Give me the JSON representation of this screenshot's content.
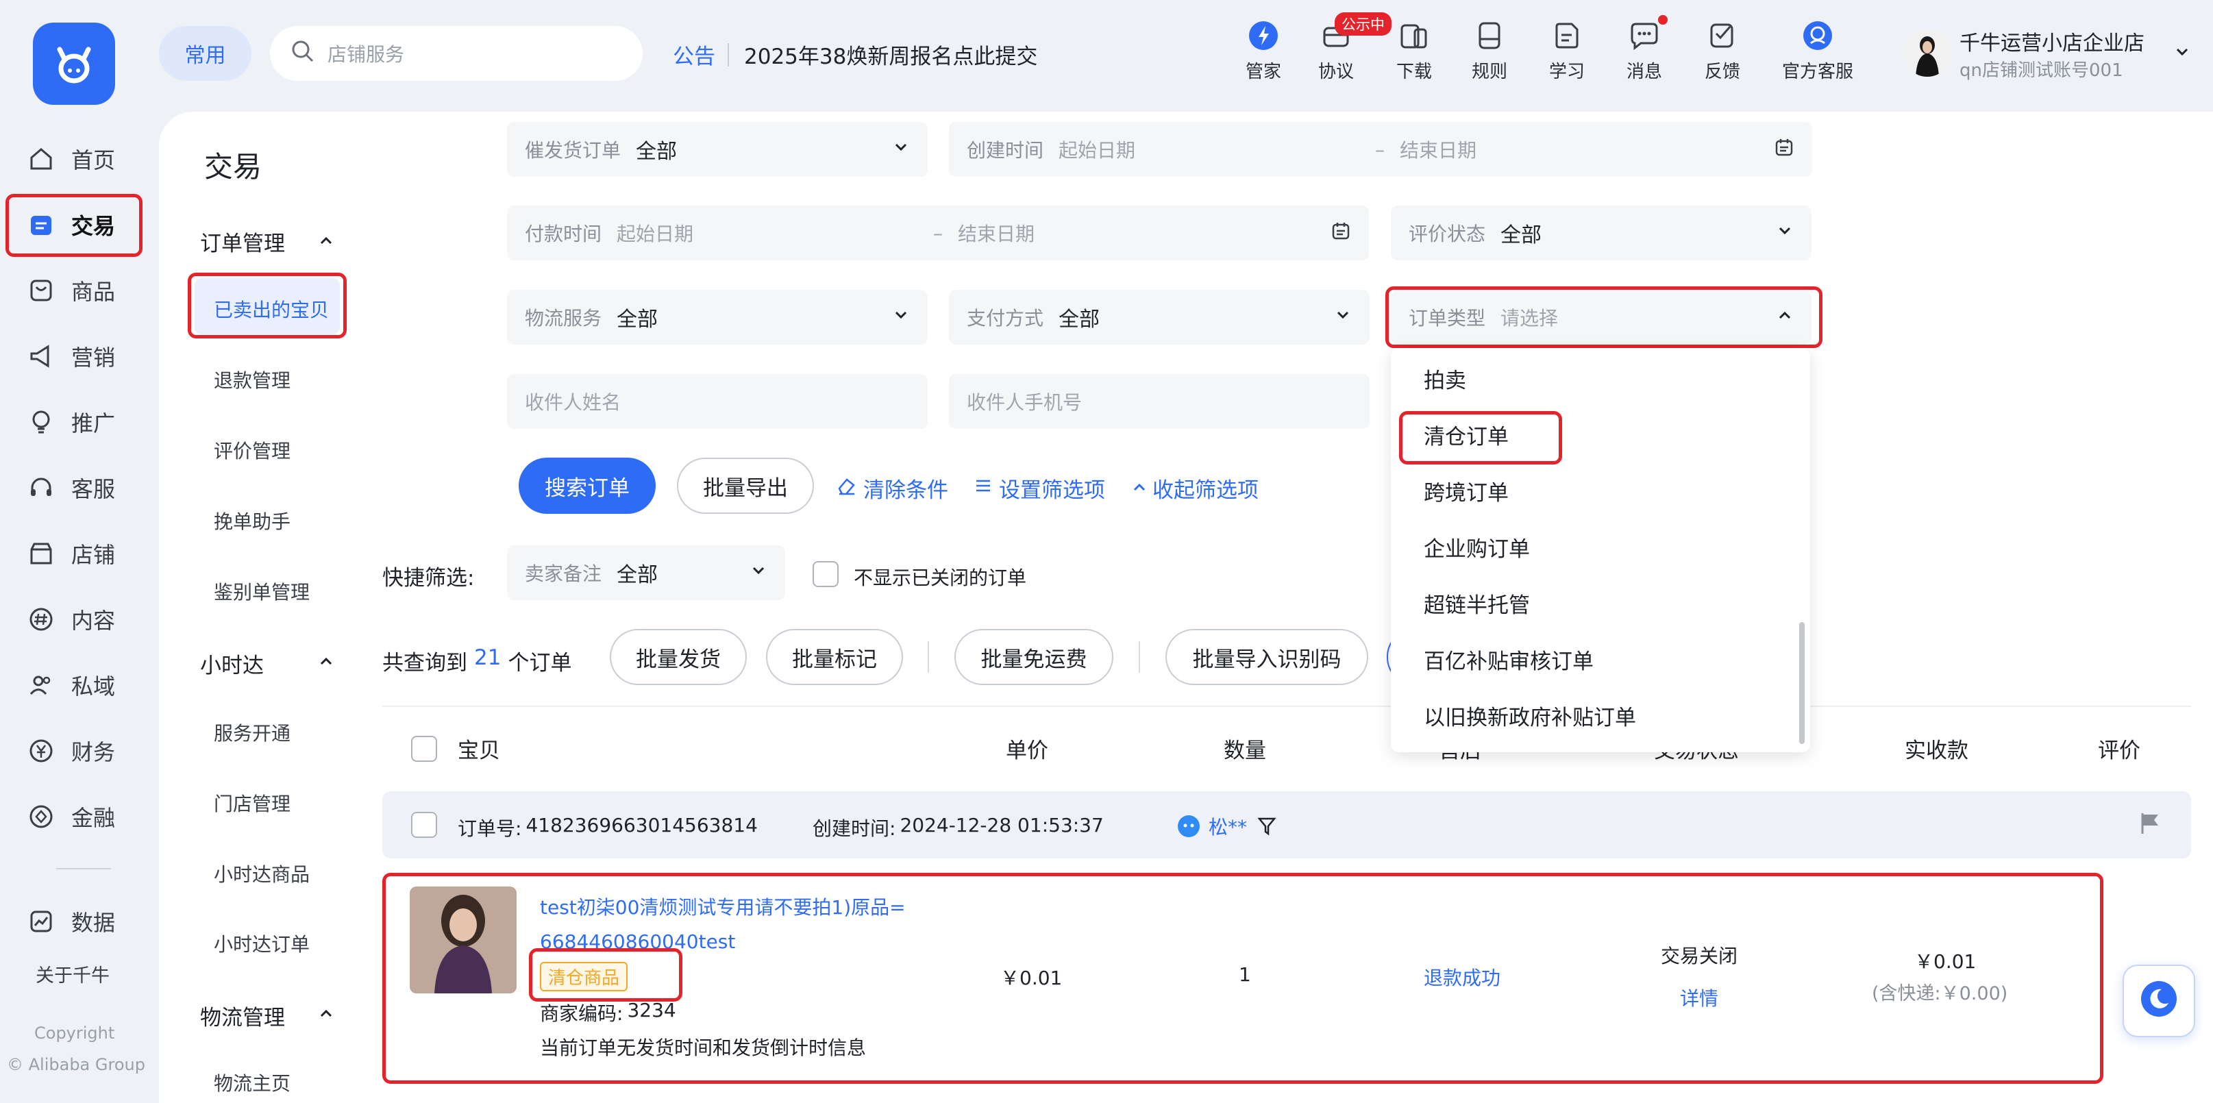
{
  "nav": {
    "items": [
      {
        "label": "首页",
        "icon": "home-icon"
      },
      {
        "label": "交易",
        "icon": "trade-icon"
      },
      {
        "label": "商品",
        "icon": "goods-icon"
      },
      {
        "label": "营销",
        "icon": "megaphone-icon"
      },
      {
        "label": "推广",
        "icon": "bulb-icon"
      },
      {
        "label": "客服",
        "icon": "headset-icon"
      },
      {
        "label": "店铺",
        "icon": "store-icon"
      },
      {
        "label": "内容",
        "icon": "hash-icon"
      },
      {
        "label": "私域",
        "icon": "users-icon"
      },
      {
        "label": "财务",
        "icon": "yen-icon"
      },
      {
        "label": "金融",
        "icon": "finance-icon"
      }
    ],
    "data_label": "数据",
    "about": "关于千牛",
    "copyright": "Copyright",
    "company": "© Alibaba Group"
  },
  "header": {
    "common": "常用",
    "search_placeholder": "店铺服务",
    "notice_label": "公告",
    "notice_text": "2025年38焕新周报名点此提交",
    "tools": [
      {
        "label": "管家",
        "icon": "butler-icon"
      },
      {
        "label": "协议",
        "icon": "agreement-icon",
        "badge": "公示中"
      },
      {
        "label": "下载",
        "icon": "download-icon"
      },
      {
        "label": "规则",
        "icon": "rules-icon"
      },
      {
        "label": "学习",
        "icon": "learn-icon"
      },
      {
        "label": "消息",
        "icon": "message-icon"
      },
      {
        "label": "反馈",
        "icon": "feedback-icon"
      },
      {
        "label": "官方客服",
        "icon": "official-service-icon"
      }
    ],
    "user": {
      "shop": "千牛运营小店企业店",
      "account": "qn店铺测试账号001"
    }
  },
  "sidebar": {
    "title": "交易",
    "groups": [
      {
        "label": "订单管理",
        "items": [
          "已卖出的宝贝",
          "退款管理",
          "评价管理",
          "挽单助手",
          "鉴别单管理"
        ]
      },
      {
        "label": "小时达",
        "items": [
          "服务开通",
          "门店管理",
          "小时达商品",
          "小时达订单"
        ]
      },
      {
        "label": "物流管理",
        "items": [
          "物流主页"
        ]
      }
    ]
  },
  "filters": {
    "remind": {
      "label": "催发货订单",
      "value": "全部"
    },
    "created": {
      "label": "创建时间",
      "start": "起始日期",
      "end": "结束日期"
    },
    "paid": {
      "label": "付款时间",
      "start": "起始日期",
      "end": "结束日期"
    },
    "review": {
      "label": "评价状态",
      "value": "全部"
    },
    "logistics": {
      "label": "物流服务",
      "value": "全部"
    },
    "payment": {
      "label": "支付方式",
      "value": "全部"
    },
    "order_type": {
      "label": "订单类型",
      "placeholder": "请选择"
    },
    "receiver_name": "收件人姓名",
    "receiver_phone": "收件人手机号",
    "search_btn": "搜索订单",
    "export_btn": "批量导出",
    "clear": "清除条件",
    "set_filters": "设置筛选项",
    "collapse": "收起筛选项",
    "dash": "–"
  },
  "quick": {
    "label": "快捷筛选:",
    "remark_label": "卖家备注",
    "remark_value": "全部",
    "hide_closed": "不显示已关闭的订单"
  },
  "summary": {
    "prefix": "共查询到",
    "count": "21",
    "suffix": "个订单",
    "actions": [
      "批量发货",
      "批量标记",
      "批量免运费",
      "批量导入识别码"
    ]
  },
  "dropdown": {
    "options": [
      "拍卖",
      "清仓订单",
      "跨境订单",
      "企业购订单",
      "超链半托管",
      "百亿补贴审核订单",
      "以旧换新政府补贴订单"
    ]
  },
  "table": {
    "headers": {
      "item": "宝贝",
      "price": "单价",
      "qty": "数量",
      "aftersale": "售后",
      "status": "交易状态",
      "received": "实收款",
      "review": "评价"
    }
  },
  "order": {
    "no_label": "订单号:",
    "no": "4182369663014563814",
    "time_label": "创建时间:",
    "time": "2024-12-28 01:53:37",
    "buyer": "松**",
    "title_line1": "test初柒00清烦测试专用请不要拍1)原品=",
    "title_line2": "6684460860040test",
    "tag": "清仓商品",
    "code_label": "商家编码:",
    "code": "3234",
    "ship_note": "当前订单无发货时间和发货倒计时信息",
    "price": "￥0.01",
    "qty": "1",
    "aftersale": "退款成功",
    "status": "交易关闭",
    "detail": "详情",
    "received": "￥0.01",
    "shipping": "(含快递:￥0.00)"
  },
  "colors": {
    "accent": "#2f6cf6",
    "highlight": "#e4232b",
    "tag": "#f5a623"
  }
}
